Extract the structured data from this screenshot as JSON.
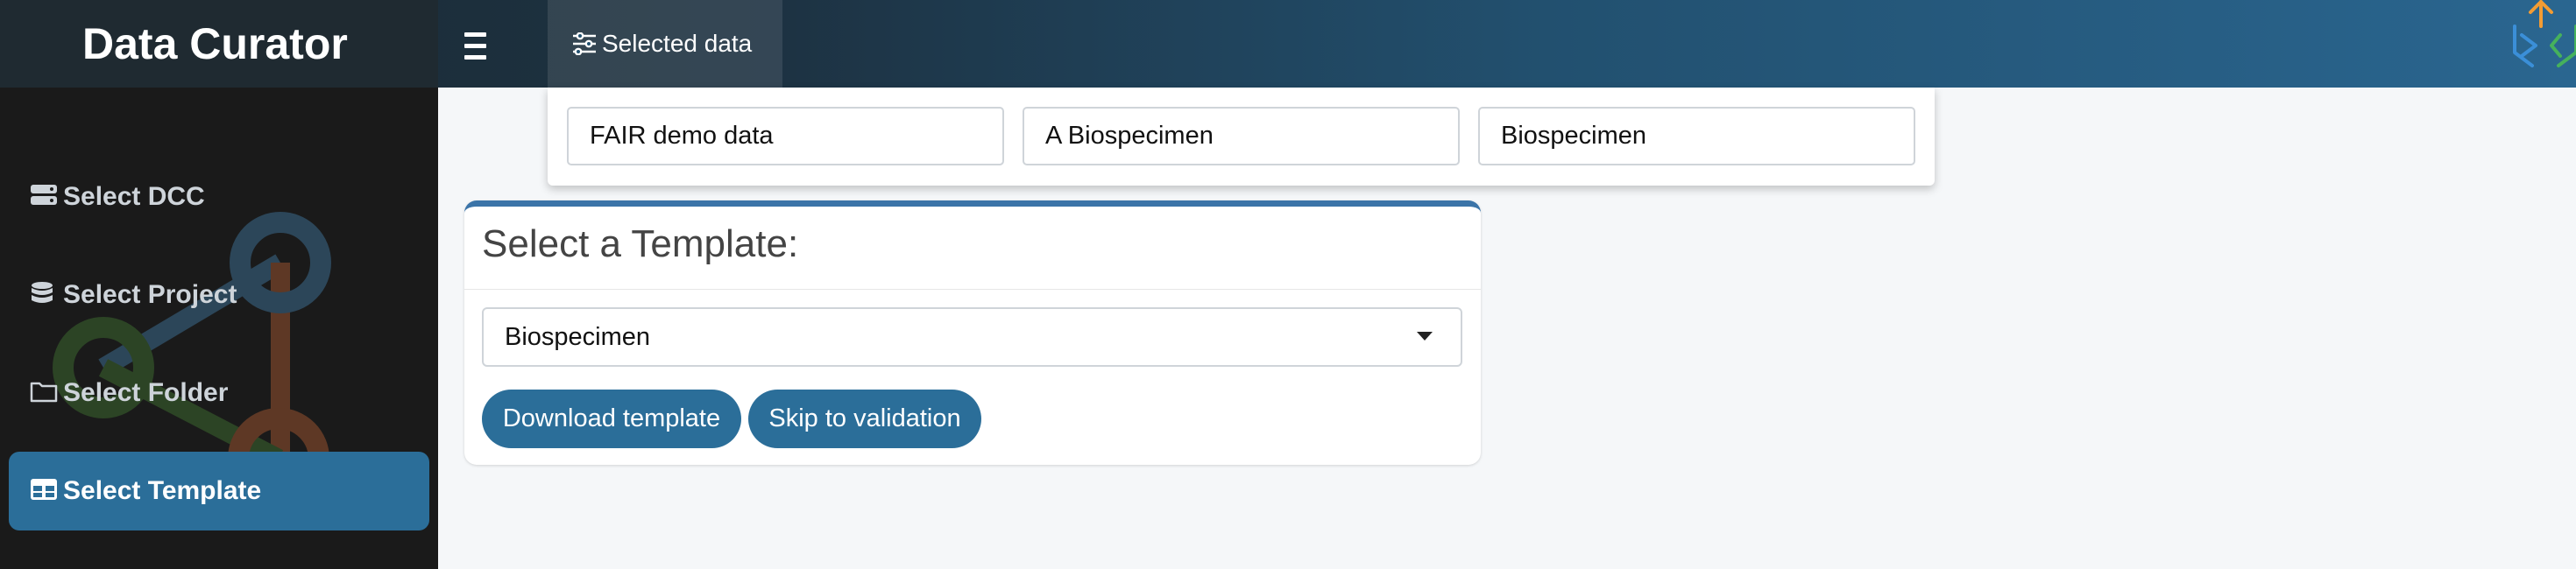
{
  "header": {
    "brand": "Data Curator",
    "selected_tab": "Selected data"
  },
  "sidebar": {
    "items": [
      {
        "label": "Select DCC",
        "icon": "server-icon",
        "active": false
      },
      {
        "label": "Select Project",
        "icon": "database-icon",
        "active": false
      },
      {
        "label": "Select Folder",
        "icon": "folder-icon",
        "active": false
      },
      {
        "label": "Select Template",
        "icon": "table-icon",
        "active": true
      }
    ]
  },
  "selected_data": {
    "dcc": "FAIR demo data",
    "project": "A Biospecimen",
    "folder": "Biospecimen"
  },
  "template_card": {
    "title": "Select a Template:",
    "selected_template": "Biospecimen",
    "download_label": "Download template",
    "skip_label": "Skip to validation"
  },
  "colors": {
    "accent": "#2b6e99",
    "sidebar_bg": "#1a1a1a",
    "card_border": "#3b74a8"
  }
}
